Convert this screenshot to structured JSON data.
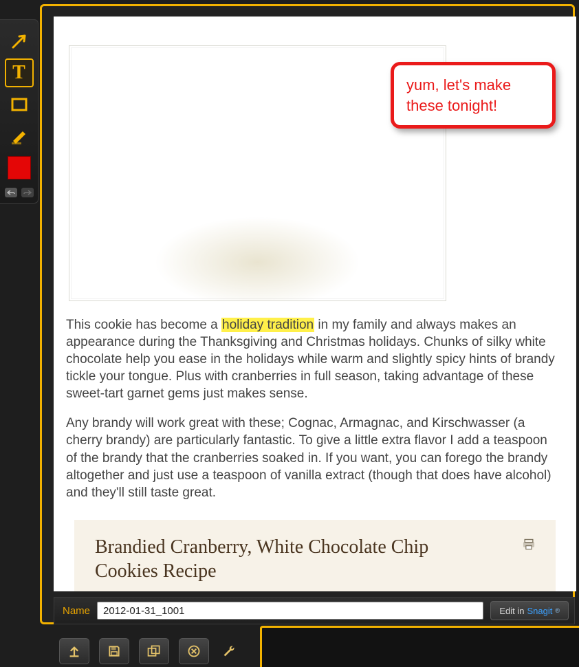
{
  "annotation": {
    "callout_text": "yum, let's make these tonight!"
  },
  "article": {
    "para1_pre": "This cookie has become a ",
    "highlight": "holiday tradition",
    "para1_post": " in my family and always makes an appearance during the Thanksgiving and Christmas holidays. Chunks of silky white chocolate help you ease in the holidays while warm and slightly spicy hints of brandy tickle your tongue. Plus with cranberries in full season, taking advantage of these sweet-tart garnet gems just makes sense.",
    "para2": "Any brandy will work great with these; Cognac, Armagnac, and Kirschwasser (a cherry brandy) are particularly fantastic. To give a little extra flavor I add a teaspoon of the brandy that the cranberries soaked in. If you want, you can forego the brandy altogether and just use a teaspoon of vanilla extract (though that does have alcohol) and they'll still taste great.",
    "recipe_title": "Brandied Cranberry, White Chocolate Chip Cookies Recipe"
  },
  "toolbar": {
    "tools": {
      "arrow": "arrow-tool",
      "text": "text-tool",
      "rect": "rectangle-tool",
      "highlighter": "highlighter-tool",
      "color": "color-picker"
    },
    "T_glyph": "T"
  },
  "footer": {
    "name_label": "Name",
    "name_value": "2012-01-31_1001",
    "edit_label": "Edit in ",
    "edit_brand": "Snagit"
  },
  "colors": {
    "accent": "#f3b200",
    "annotation_red": "#ea1a1a",
    "highlight_yellow": "#fff04a"
  }
}
